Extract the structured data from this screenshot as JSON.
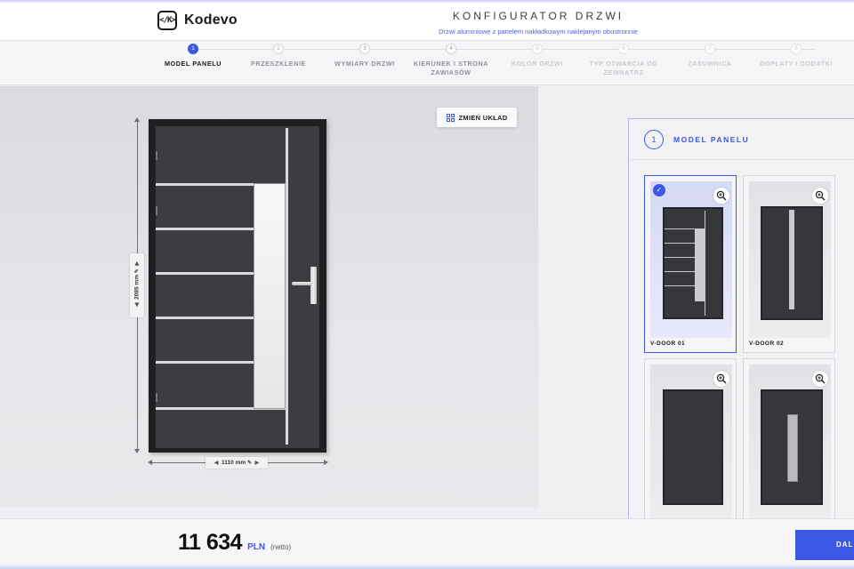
{
  "header": {
    "logo_mark": "</K>",
    "logo_text": "Kodevo",
    "title": "KONFIGURATOR DRZWI",
    "subtitle": "Drzwi aluminiowe z panelem nakładkowym naklejanym obustronnie"
  },
  "steps": [
    {
      "num": "1",
      "label": "MODEL PANELU"
    },
    {
      "num": "2",
      "label": "PRZESZKLENIE"
    },
    {
      "num": "3",
      "label": "WYMIARY DRZWI"
    },
    {
      "num": "4",
      "label": "KIERUNEK I STRONA ZAWIASÓW"
    },
    {
      "num": "5",
      "label": "KOLOR DRZWI"
    },
    {
      "num": "6",
      "label": "TYP OTWARCIA OD ZEWNĄTRZ"
    },
    {
      "num": "7",
      "label": "ZASUWNICA"
    },
    {
      "num": "8",
      "label": "DOPŁATY I DODATKI"
    }
  ],
  "preview": {
    "layout_button": "ZMIEŃ UKŁAD",
    "height_label": "2085 mm",
    "width_label": "1110 mm"
  },
  "panel": {
    "number": "1",
    "title": "MODEL PANELU",
    "models": [
      {
        "label": "V-DOOR 01",
        "selected": true
      },
      {
        "label": "V-DOOR 02",
        "selected": false
      },
      {
        "label": "",
        "selected": false
      },
      {
        "label": "",
        "selected": false
      }
    ]
  },
  "footer": {
    "price": "11 634",
    "currency": "PLN",
    "note": "(netto)",
    "next_button": "DAL"
  },
  "colors": {
    "accent": "#3c57e3",
    "door": "#3b3d41",
    "background": "#eeeff2"
  }
}
